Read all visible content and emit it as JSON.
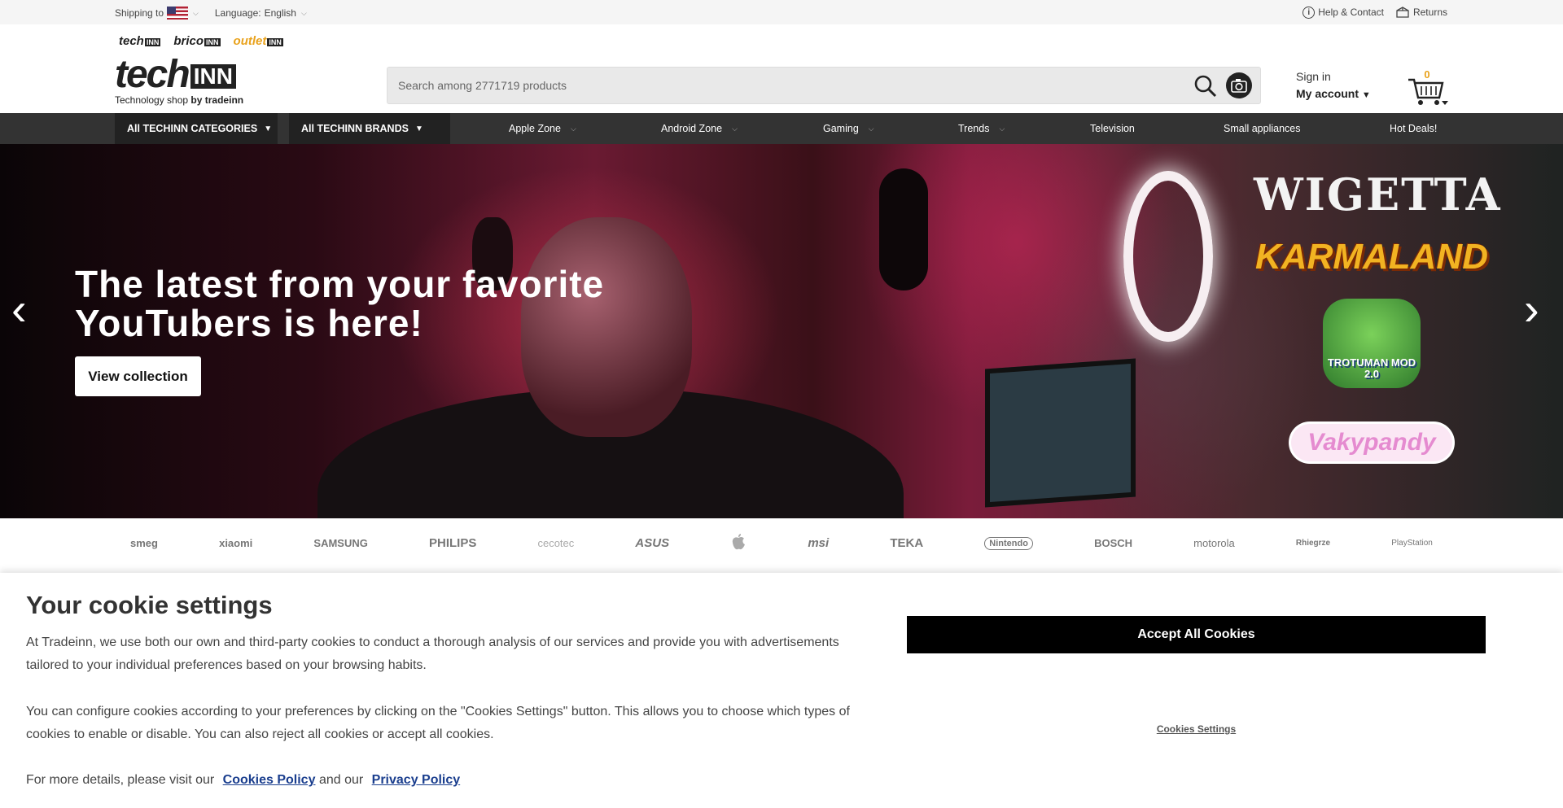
{
  "topbar": {
    "shipping_label": "Shipping to",
    "language_label": "Language:",
    "language_value": "English",
    "help_label": "Help & Contact",
    "returns_label": "Returns"
  },
  "header": {
    "shops": [
      {
        "name": "tech",
        "tag": "INN"
      },
      {
        "name": "brico",
        "tag": "INN"
      },
      {
        "name": "outlet",
        "tag": "INN"
      }
    ],
    "logo_word": "tech",
    "logo_tag": "INN",
    "tagline": "Technology shop",
    "tagline_by": "by tradeinn",
    "search_placeholder": "Search among 2771719 products",
    "signin_label": "Sign in",
    "account_label": "My account",
    "cart_count": "0"
  },
  "nav": {
    "categories_label": "All TECHINN CATEGORIES",
    "brands_label": "All TECHINN BRANDS",
    "links": [
      "Apple Zone",
      "Android Zone",
      "Gaming",
      "Trends",
      "Television",
      "Small appliances",
      "Hot Deals!"
    ]
  },
  "hero": {
    "headline_line1": "The latest from your favorite",
    "headline_line2": "YouTubers is here!",
    "cta_label": "View collection",
    "names": [
      "WIGETTA",
      "KARMALAND",
      "TROTUMAN MOD 2.0",
      "Vakypandy"
    ]
  },
  "brand_strip": [
    "smeg",
    "xiaomi",
    "SAMSUNG",
    "PHILIPS",
    "cecotec",
    "ASUS",
    "",
    "msi",
    "TEKA",
    "Nintendo",
    "BOSCH",
    "motorola",
    "Rhiegrze",
    "PlayStation"
  ],
  "cookie": {
    "title": "Your cookie settings",
    "p1": "At Tradeinn, we use both our own and third-party cookies to conduct a thorough analysis of our services and provide you with advertisements tailored to your individual preferences based on your browsing habits.",
    "p2": "You can configure cookies according to your preferences by clicking on the \"Cookies Settings\" button. This allows you to choose which types of cookies to enable or disable. You can also reject all cookies or accept all cookies.",
    "p3_prefix": "For more details, please visit our",
    "cookies_policy": "Cookies Policy",
    "and": "and our",
    "privacy_policy": "Privacy Policy",
    "accept_label": "Accept All Cookies",
    "settings_label": "Cookies Settings"
  },
  "colors": {
    "accent": "#e9a21c",
    "nav_bg": "#333333",
    "link": "#1a3e8e"
  }
}
